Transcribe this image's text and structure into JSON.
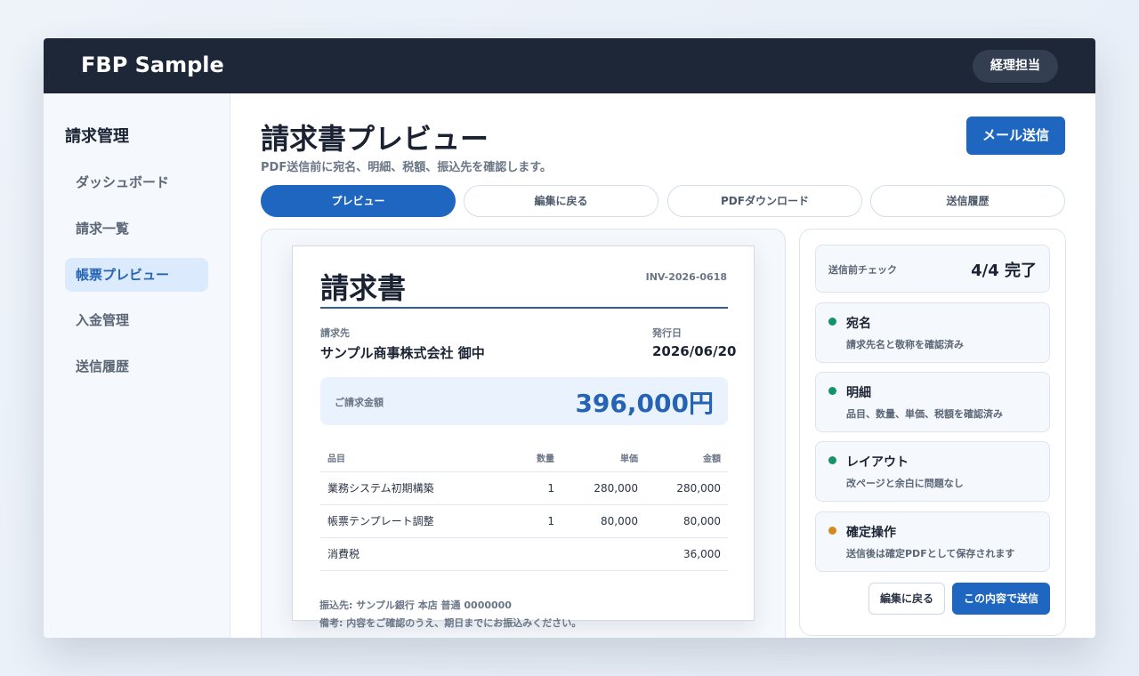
{
  "app": {
    "brand": "FBP Sample",
    "role": "経理担当"
  },
  "sidebar": {
    "title": "請求管理",
    "items": [
      {
        "label": "ダッシュボード",
        "active": false
      },
      {
        "label": "請求一覧",
        "active": false
      },
      {
        "label": "帳票プレビュー",
        "active": true
      },
      {
        "label": "入金管理",
        "active": false
      },
      {
        "label": "送信履歴",
        "active": false
      }
    ]
  },
  "header": {
    "title": "請求書プレビュー",
    "subtitle": "PDF送信前に宛名、明細、税額、振込先を確認します。",
    "mail_button": "メール送信"
  },
  "tabs": [
    {
      "label": "プレビュー",
      "active": true
    },
    {
      "label": "編集に戻る",
      "active": false
    },
    {
      "label": "PDFダウンロード",
      "active": false
    },
    {
      "label": "送信履歴",
      "active": false
    }
  ],
  "invoice": {
    "title": "請求書",
    "number": "INV-2026-0618",
    "billto_label": "請求先",
    "billto": "サンプル商事株式会社 御中",
    "date_label": "発行日",
    "date": "2026/06/20",
    "amount_label": "ご請求金額",
    "amount": "396,000円",
    "columns": [
      "品目",
      "数量",
      "単価",
      "金額"
    ],
    "rows": [
      [
        "業務システム初期構築",
        "1",
        "280,000",
        "280,000"
      ],
      [
        "帳票テンプレート調整",
        "1",
        "80,000",
        "80,000"
      ],
      [
        "消費税",
        "",
        "",
        "36,000"
      ]
    ],
    "bank": "振込先: サンプル銀行 本店 普通 0000000",
    "note": "備考: 内容をご確認のうえ、期日までにお振込みください。"
  },
  "checks": {
    "label": "送信前チェック",
    "status": "4/4 完了",
    "items": [
      {
        "title": "宛名",
        "desc": "請求先名と敬称を確認済み",
        "color": "#149268"
      },
      {
        "title": "明細",
        "desc": "品目、数量、単価、税額を確認済み",
        "color": "#149268"
      },
      {
        "title": "レイアウト",
        "desc": "改ページと余白に問題なし",
        "color": "#149268"
      },
      {
        "title": "確定操作",
        "desc": "送信後は確定PDFとして保存されます",
        "color": "#d58a1e"
      }
    ],
    "back_button": "編集に戻る",
    "send_button": "この内容で送信"
  },
  "colors": {
    "topbar": "#1e2738",
    "accent": "#1f66c1",
    "ok": "#149268",
    "warn": "#d58a1e"
  }
}
